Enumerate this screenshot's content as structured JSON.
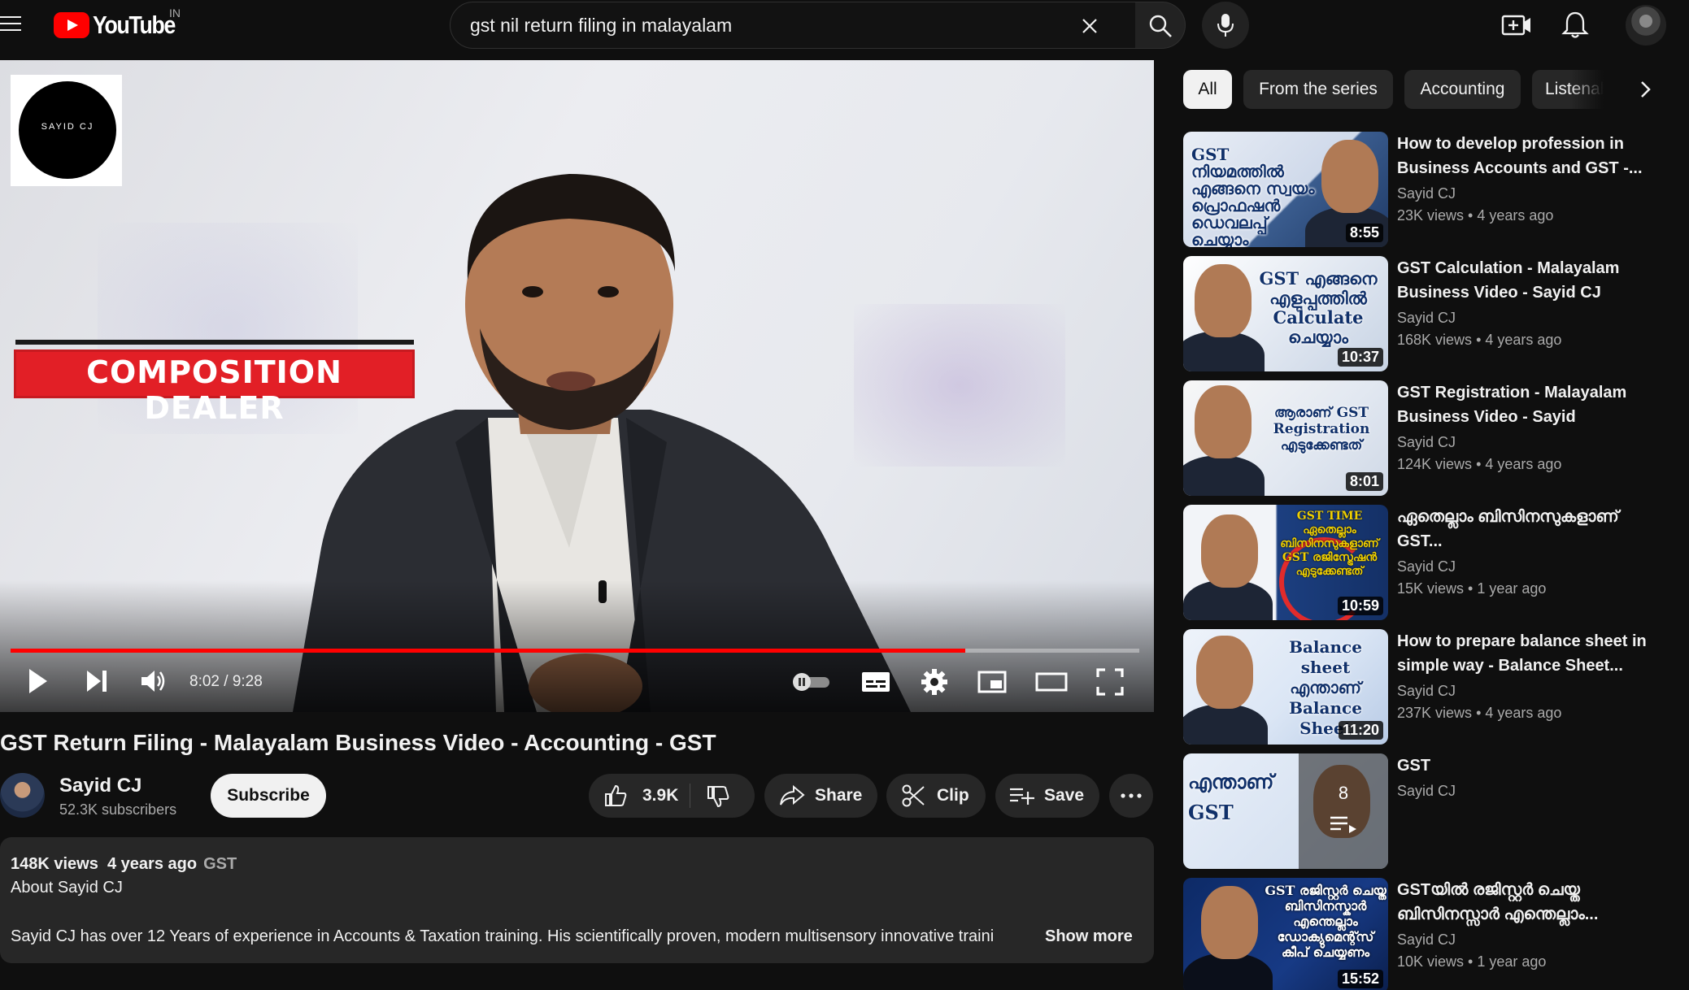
{
  "header": {
    "logo_text": "YouTube",
    "country_code": "IN",
    "search_value": "gst nil return filing in malayalam"
  },
  "player": {
    "watermark_text": "SAYID CJ",
    "overlay_text": "COMPOSITION DEALER",
    "current_time": "8:02",
    "duration": "9:28",
    "time_display": "8:02 / 9:28",
    "progress_fraction": 0.846
  },
  "video": {
    "title": "GST Return Filing - Malayalam Business Video - Accounting - GST",
    "channel_name": "Sayid CJ",
    "subscribers": "52.3K subscribers",
    "subscribe_label": "Subscribe",
    "likes": "3.9K",
    "share_label": "Share",
    "clip_label": "Clip",
    "save_label": "Save"
  },
  "description": {
    "views": "148K views",
    "age": "4 years ago",
    "tag": "GST",
    "about": "About Sayid CJ",
    "text": "Sayid CJ has over 12 Years of experience in Accounts & Taxation training. His scientifically proven, modern multisensory innovative traini",
    "show_more": "Show more"
  },
  "chips": [
    {
      "label": "All",
      "active": true
    },
    {
      "label": "From the series",
      "active": false
    },
    {
      "label": "Accounting",
      "active": false
    },
    {
      "label": "Listenab",
      "active": false
    }
  ],
  "recommendations": [
    {
      "title": "How to develop profession in Business Accounts and GST -...",
      "channel": "Sayid CJ",
      "views": "23K views",
      "age": "4 years ago",
      "duration": "8:55",
      "thumb_text": "GST നിയമത്തിൽ എങ്ങനെ സ്വയം പ്രൊഫഷൻ ഡെവലപ്പ് ചെയ്യാം"
    },
    {
      "title": "GST Calculation - Malayalam Business Video - Sayid CJ",
      "channel": "Sayid CJ",
      "views": "168K views",
      "age": "4 years ago",
      "duration": "10:37",
      "thumb_text": "GST എങ്ങനെ എളുപ്പത്തിൽ Calculate ചെയ്യാം"
    },
    {
      "title": "GST Registration - Malayalam Business Video - Sayid",
      "channel": "Sayid CJ",
      "views": "124K views",
      "age": "4 years ago",
      "duration": "8:01",
      "thumb_text": "ആരാണ് GST Registration എടുക്കേണ്ടത്"
    },
    {
      "title": "ഏതെല്ലാം ബിസിനസുകളാണ് GST...",
      "channel": "Sayid CJ",
      "views": "15K views",
      "age": "1 year ago",
      "duration": "10:59",
      "thumb_text": "GST TIME ഏതെല്ലാം ബിസിനസുകളാണ് GST രജിസ്ട്രേഷൻ എടുക്കേണ്ടത്"
    },
    {
      "title": "How to prepare balance sheet in simple way - Balance Sheet...",
      "channel": "Sayid CJ",
      "views": "237K views",
      "age": "4 years ago",
      "duration": "11:20",
      "thumb_text": "Balance sheet എന്താണ് Balance Sheet"
    },
    {
      "title": "GST",
      "channel": "Sayid CJ",
      "playlist_count": "8",
      "thumb_text": "എന്താണ് GST"
    },
    {
      "title": "GSTയിൽ രജിസ്റ്റർ ചെയ്ത ബിസിനസ്സാർ എന്തെല്ലാം...",
      "channel": "Sayid CJ",
      "views": "10K views",
      "age": "1 year ago",
      "duration": "15:52",
      "thumb_text": "GST രജിസ്റ്റർ ചെയ്ത ബിസിനസ്കാർ എന്തെല്ലാം ഡോക്യുമെന്റ്സ് കീപ് ചെയ്യണം"
    }
  ]
}
